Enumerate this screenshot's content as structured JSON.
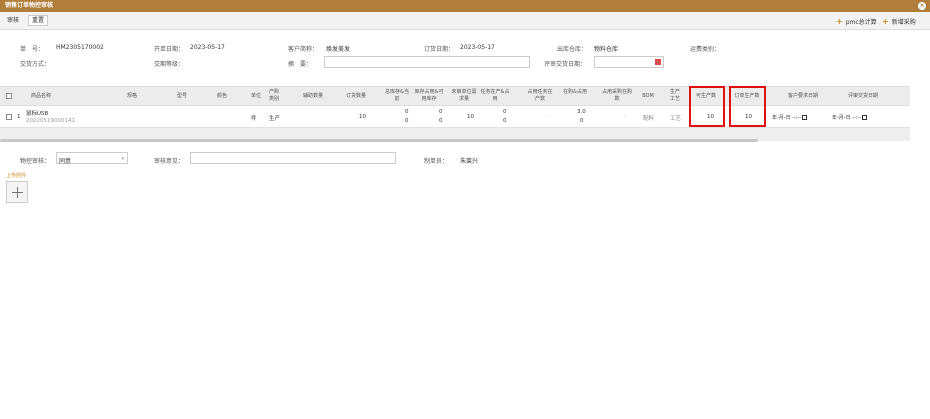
{
  "window": {
    "title": "销售订单物控审核",
    "close_icon": "close-icon"
  },
  "toolbar": {
    "tab_audit": "审核",
    "tab_reset": "重置",
    "pmc_calc": "pmc总计算",
    "new_purchase": "新增采购"
  },
  "header": {
    "doc_no_label": "单　号：",
    "doc_no": "HM2305170002",
    "open_date_label": "开单日期：",
    "open_date": "2023-05-17",
    "customer_label": "客户简称：",
    "customer": "焕发美发",
    "order_date_label": "订货日期：",
    "order_date": "2023-05-17",
    "warehouse_label": "出库仓库：",
    "warehouse": "物料仓库",
    "freight_label": "运费类别：",
    "freight": "",
    "trade_label": "交货方式：",
    "trade": "",
    "trade_level_label": "交期等级：",
    "trade_level": "",
    "summary_label": "摘　要：",
    "summary": "",
    "review_date_label": "评审交货日期："
  },
  "grid": {
    "columns": [
      "商品名称",
      "规格",
      "型号",
      "颜色",
      "单位",
      "产购类别",
      "辅助数量",
      "订货数量",
      "总库存&当前",
      "库存占用&可用库存",
      "未审单位需求量",
      "任务在产&占用",
      "占用任务在产数",
      "在购&占用",
      "占用采购在购数",
      "BOM",
      "生产工艺",
      "可生产数",
      "订单生产数",
      "客户要求日期",
      "评审交货日期"
    ],
    "rows": [
      {
        "index": "1",
        "name": "鼠标USB",
        "code": "202205190001​41",
        "spec": "",
        "model": "",
        "color": "",
        "unit": "件",
        "type": "生产",
        "aux_qty": "",
        "order_qty": "10",
        "stock_total": "0",
        "stock_current": "0",
        "occupy": "0",
        "available": "0",
        "unreviewed": "10",
        "task_producing": "0",
        "task_occupy": "0",
        "task_occ_producing": "-",
        "purchasing": "3.0",
        "purchase_occupy": "0",
        "occ_purchasing": "-",
        "bom": "配料",
        "craft": "工艺",
        "can_produce": "10",
        "order_produce": "10",
        "customer_date": "年-月-日 --:--",
        "review_date": "年-月-日 --:--"
      }
    ]
  },
  "footer": {
    "mc_audit_label": "物控审核：",
    "mc_audit_value": "同意",
    "opinion_label": "审核意见：",
    "opinion": "",
    "maker_label": "制单员：",
    "maker": "朱莱兴",
    "upload_label": "上传附件"
  }
}
